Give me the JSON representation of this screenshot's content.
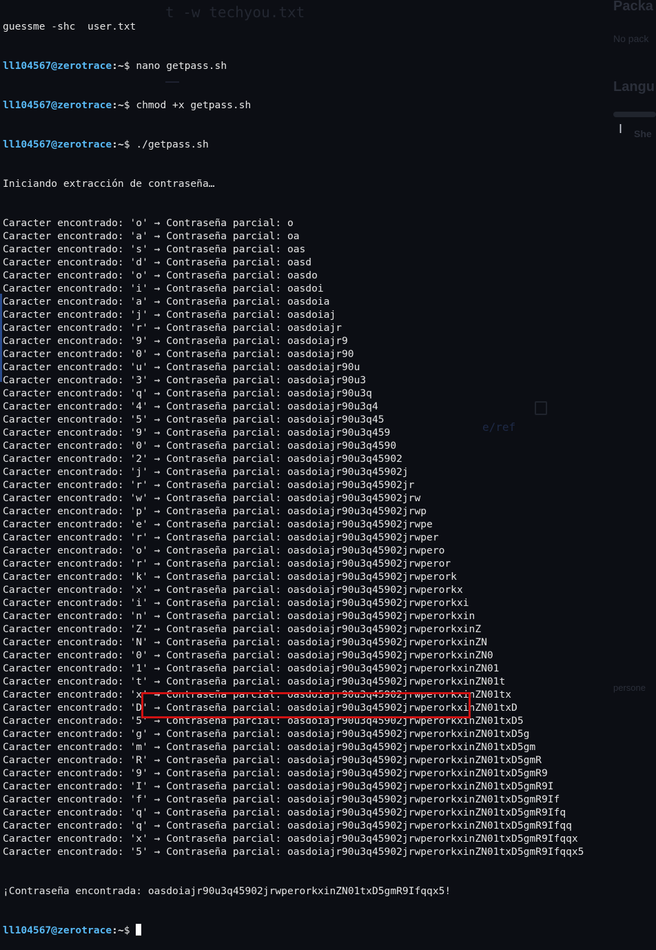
{
  "background_hints": {
    "packages_heading": "Packa",
    "no_packages": "No pack",
    "language_heading": "Langu",
    "shell_item": "She",
    "faint_command": "t -w techyou.txt",
    "faint_ref": "e/ref",
    "faint_persona": "persone"
  },
  "terminal": {
    "first_partial_line": "guessme -shc  user.txt",
    "prompt_user": "ll104567@zerotrace",
    "prompt_path": ":~",
    "prompt_symbol": "$ ",
    "commands": [
      "nano getpass.sh",
      "chmod +x getpass.sh",
      "./getpass.sh"
    ],
    "start_message": "Iniciando extracción de contraseña…",
    "progress_prefix": "Caracter encontrado: ",
    "progress_mid": " → Contraseña parcial: ",
    "progress": [
      {
        "char": "o",
        "partial": "o"
      },
      {
        "char": "a",
        "partial": "oa"
      },
      {
        "char": "s",
        "partial": "oas"
      },
      {
        "char": "d",
        "partial": "oasd"
      },
      {
        "char": "o",
        "partial": "oasdo"
      },
      {
        "char": "i",
        "partial": "oasdoi"
      },
      {
        "char": "a",
        "partial": "oasdoia"
      },
      {
        "char": "j",
        "partial": "oasdoiaj"
      },
      {
        "char": "r",
        "partial": "oasdoiajr"
      },
      {
        "char": "9",
        "partial": "oasdoiajr9"
      },
      {
        "char": "0",
        "partial": "oasdoiajr90"
      },
      {
        "char": "u",
        "partial": "oasdoiajr90u"
      },
      {
        "char": "3",
        "partial": "oasdoiajr90u3"
      },
      {
        "char": "q",
        "partial": "oasdoiajr90u3q"
      },
      {
        "char": "4",
        "partial": "oasdoiajr90u3q4"
      },
      {
        "char": "5",
        "partial": "oasdoiajr90u3q45"
      },
      {
        "char": "9",
        "partial": "oasdoiajr90u3q459"
      },
      {
        "char": "0",
        "partial": "oasdoiajr90u3q4590"
      },
      {
        "char": "2",
        "partial": "oasdoiajr90u3q45902"
      },
      {
        "char": "j",
        "partial": "oasdoiajr90u3q45902j"
      },
      {
        "char": "r",
        "partial": "oasdoiajr90u3q45902jr"
      },
      {
        "char": "w",
        "partial": "oasdoiajr90u3q45902jrw"
      },
      {
        "char": "p",
        "partial": "oasdoiajr90u3q45902jrwp"
      },
      {
        "char": "e",
        "partial": "oasdoiajr90u3q45902jrwpe"
      },
      {
        "char": "r",
        "partial": "oasdoiajr90u3q45902jrwper"
      },
      {
        "char": "o",
        "partial": "oasdoiajr90u3q45902jrwpero"
      },
      {
        "char": "r",
        "partial": "oasdoiajr90u3q45902jrwperor"
      },
      {
        "char": "k",
        "partial": "oasdoiajr90u3q45902jrwperork"
      },
      {
        "char": "x",
        "partial": "oasdoiajr90u3q45902jrwperorkx"
      },
      {
        "char": "i",
        "partial": "oasdoiajr90u3q45902jrwperorkxi"
      },
      {
        "char": "n",
        "partial": "oasdoiajr90u3q45902jrwperorkxin"
      },
      {
        "char": "Z",
        "partial": "oasdoiajr90u3q45902jrwperorkxinZ"
      },
      {
        "char": "N",
        "partial": "oasdoiajr90u3q45902jrwperorkxinZN"
      },
      {
        "char": "0",
        "partial": "oasdoiajr90u3q45902jrwperorkxinZN0"
      },
      {
        "char": "1",
        "partial": "oasdoiajr90u3q45902jrwperorkxinZN01"
      },
      {
        "char": "t",
        "partial": "oasdoiajr90u3q45902jrwperorkxinZN01t"
      },
      {
        "char": "x",
        "partial": "oasdoiajr90u3q45902jrwperorkxinZN01tx"
      },
      {
        "char": "D",
        "partial": "oasdoiajr90u3q45902jrwperorkxinZN01txD"
      },
      {
        "char": "5",
        "partial": "oasdoiajr90u3q45902jrwperorkxinZN01txD5"
      },
      {
        "char": "g",
        "partial": "oasdoiajr90u3q45902jrwperorkxinZN01txD5g"
      },
      {
        "char": "m",
        "partial": "oasdoiajr90u3q45902jrwperorkxinZN01txD5gm"
      },
      {
        "char": "R",
        "partial": "oasdoiajr90u3q45902jrwperorkxinZN01txD5gmR"
      },
      {
        "char": "9",
        "partial": "oasdoiajr90u3q45902jrwperorkxinZN01txD5gmR9"
      },
      {
        "char": "I",
        "partial": "oasdoiajr90u3q45902jrwperorkxinZN01txD5gmR9I"
      },
      {
        "char": "f",
        "partial": "oasdoiajr90u3q45902jrwperorkxinZN01txD5gmR9If"
      },
      {
        "char": "q",
        "partial": "oasdoiajr90u3q45902jrwperorkxinZN01txD5gmR9Ifq"
      },
      {
        "char": "q",
        "partial": "oasdoiajr90u3q45902jrwperorkxinZN01txD5gmR9Ifqq"
      },
      {
        "char": "x",
        "partial": "oasdoiajr90u3q45902jrwperorkxinZN01txD5gmR9Ifqqx"
      },
      {
        "char": "5",
        "partial": "oasdoiajr90u3q45902jrwperorkxinZN01txD5gmR9Ifqqx5"
      }
    ],
    "found_label": "¡Contraseña encontrada: ",
    "found_password": "oasdoiajr90u3q45902jrwperorkxinZN01txD5gmR9Ifqqx5!",
    "highlight_color": "#d11212"
  }
}
